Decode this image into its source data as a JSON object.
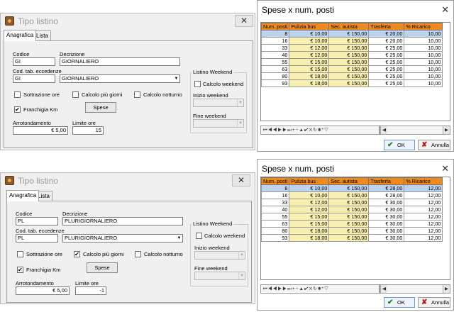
{
  "top": {
    "listino": {
      "title": "Tipo listino",
      "close": "✕",
      "tabs": [
        "Anagrafica",
        "Lista"
      ],
      "codice_label": "Codice",
      "codice_value": "GI",
      "decrizione_label": "Decrizione",
      "decrizione_value": "GIORNALIERO",
      "cod_tab_label": "Cod. tab. eccedenze",
      "cod_tab_code": "GI",
      "cod_tab_desc": "GIORNALIERO",
      "sottrazione_label": "Sottrazione ore",
      "sottrazione_checked": false,
      "calcolo_piu_label": "Calcolo più giorni",
      "calcolo_piu_checked": false,
      "calcolo_notturno_label": "Calcolo notturno",
      "calcolo_notturno_checked": false,
      "franchigia_label": "Franchigia Km",
      "franchigia_checked": true,
      "spese_label": "Spese",
      "arrotondamento_label": "Arrotondamento",
      "arrotondamento_value": "€ 5,00",
      "limite_label": "Limite ore",
      "limite_value": "15",
      "weekend_group": "Listino Weekend",
      "calcolo_weekend_label": "Calcolo weekend",
      "calcolo_weekend_checked": false,
      "inizio_label": "Inizio weekend",
      "fine_label": "Fine weekend"
    },
    "spese": {
      "title": "Spese x num. posti",
      "close": "✕",
      "columns": [
        "Num. posti",
        "Pulizia bus",
        "Sec. autista",
        "Trasferta",
        "% Ricarico"
      ],
      "rows": [
        [
          "8",
          "€ 10,00",
          "€ 150,00",
          "€ 20,00",
          "10,00"
        ],
        [
          "16",
          "€ 10,00",
          "€ 150,00",
          "€ 20,00",
          "10,00"
        ],
        [
          "33",
          "€ 12,00",
          "€ 150,00",
          "€ 25,00",
          "10,00"
        ],
        [
          "40",
          "€ 12,00",
          "€ 150,00",
          "€ 25,00",
          "10,00"
        ],
        [
          "55",
          "€ 15,00",
          "€ 150,00",
          "€ 25,00",
          "10,00"
        ],
        [
          "63",
          "€ 15,00",
          "€ 150,00",
          "€ 25,00",
          "10,00"
        ],
        [
          "80",
          "€ 18,00",
          "€ 150,00",
          "€ 25,00",
          "10,00"
        ],
        [
          "93",
          "€ 18,00",
          "€ 150,00",
          "€ 25,00",
          "10,00"
        ]
      ],
      "selected_row": 0,
      "navigator": "⏮◀◀▶▶⏭+−▲✔✕↻✱*▽",
      "ok_label": "OK",
      "annulla_label": "Annulla"
    }
  },
  "bottom": {
    "listino": {
      "title": "Tipo listino",
      "close": "✕",
      "tabs": [
        "Anagrafica",
        "Lista"
      ],
      "codice_label": "Codice",
      "codice_value": "PL",
      "decrizione_label": "Decrizione",
      "decrizione_value": "PLURIGIORNALIERO",
      "cod_tab_label": "Cod. tab. eccedenze",
      "cod_tab_code": "PL",
      "cod_tab_desc": "PLURIGIORNALIERO",
      "sottrazione_label": "Sottrazione ore",
      "sottrazione_checked": false,
      "calcolo_piu_label": "Calcolo più giorni",
      "calcolo_piu_checked": true,
      "calcolo_notturno_label": "Calcolo notturno",
      "calcolo_notturno_checked": false,
      "franchigia_label": "Franchigia Km",
      "franchigia_checked": true,
      "spese_label": "Spese",
      "arrotondamento_label": "Arrotondamento",
      "arrotondamento_value": "€ 5,00",
      "limite_label": "Limite ore",
      "limite_value": "-1",
      "weekend_group": "Listino Weekend",
      "calcolo_weekend_label": "Calcolo weekend",
      "calcolo_weekend_checked": false,
      "inizio_label": "Inizio weekend",
      "fine_label": "Fine weekend"
    },
    "spese": {
      "title": "Spese x num. posti",
      "close": "✕",
      "columns": [
        "Num. posti",
        "Pulizia bus",
        "Sec. autista",
        "Trasferta",
        "% Ricarico"
      ],
      "rows": [
        [
          "8",
          "€ 10,00",
          "€ 150,00",
          "€ 28,00",
          "12,00"
        ],
        [
          "16",
          "€ 10,00",
          "€ 150,00",
          "€ 28,00",
          "12,00"
        ],
        [
          "33",
          "€ 12,00",
          "€ 150,00",
          "€ 30,00",
          "12,00"
        ],
        [
          "40",
          "€ 12,00",
          "€ 150,00",
          "€ 30,00",
          "12,00"
        ],
        [
          "55",
          "€ 15,00",
          "€ 150,00",
          "€ 30,00",
          "12,00"
        ],
        [
          "63",
          "€ 15,00",
          "€ 150,00",
          "€ 30,00",
          "12,00"
        ],
        [
          "80",
          "€ 18,00",
          "€ 150,00",
          "€ 30,00",
          "12,00"
        ],
        [
          "93",
          "€ 18,00",
          "€ 150,00",
          "€ 30,00",
          "12,00"
        ]
      ],
      "selected_row": 0,
      "navigator": "⏮◀◀▶▶⏭+−▲✔✕↻✱*▽",
      "ok_label": "OK",
      "annulla_label": "Annulla"
    }
  }
}
